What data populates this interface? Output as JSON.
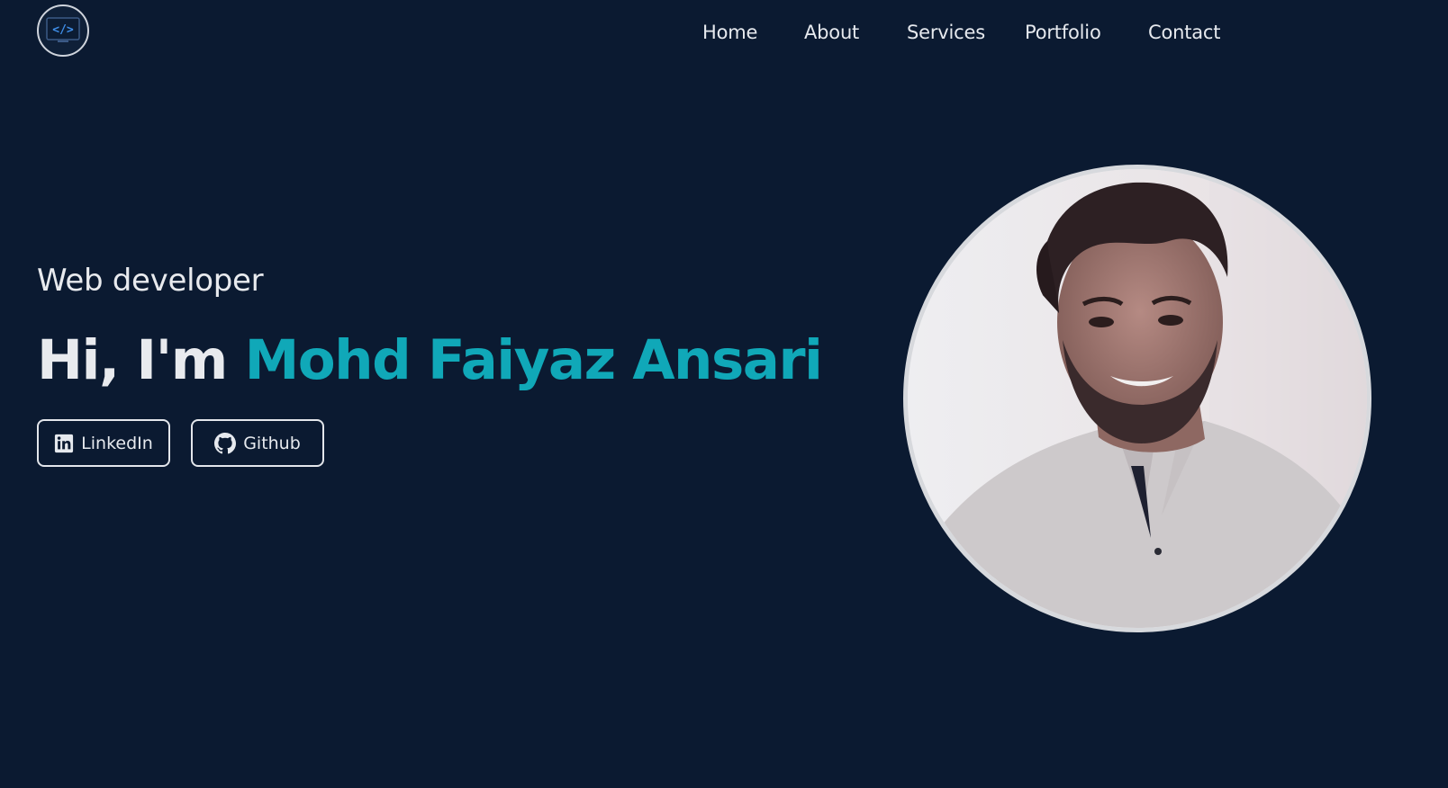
{
  "brand": {
    "logo_icon": "code-brackets-icon",
    "logo_text": "</>"
  },
  "nav": {
    "items": [
      {
        "label": "Home"
      },
      {
        "label": "About"
      },
      {
        "label": "Services"
      },
      {
        "label": "Portfolio"
      },
      {
        "label": "Contact"
      }
    ]
  },
  "hero": {
    "role": "Web developer",
    "greeting": "Hi, I'm",
    "name": "Mohd Faiyaz Ansari",
    "buttons": {
      "linkedin": {
        "label": "LinkedIn",
        "icon": "linkedin-icon"
      },
      "github": {
        "label": "Github",
        "icon": "github-icon"
      }
    },
    "photo_alt": "profile-photo"
  },
  "colors": {
    "background": "#0b1a31",
    "accent": "#10a8b8",
    "text": "#e8eaee"
  }
}
